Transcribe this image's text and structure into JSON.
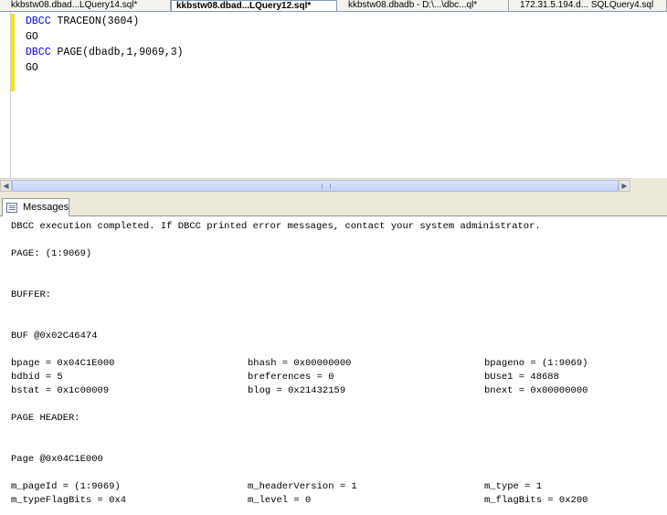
{
  "tabs": [
    {
      "label": "kkbstw08.dbad...LQuery14.sql*",
      "active": false
    },
    {
      "label": "kkbstw08.dbad...LQuery12.sql*",
      "active": true
    },
    {
      "label": "kkbstw08.dbadb - D:\\...\\dbc...ql*",
      "active": false
    },
    {
      "label": "172.31.5.194.d... SQLQuery4.sql",
      "active": false
    }
  ],
  "editor": {
    "lines": [
      {
        "kw": "DBCC",
        "rest": " TRACEON(3604)"
      },
      {
        "kw": "",
        "rest": "GO"
      },
      {
        "kw": "DBCC",
        "rest": " PAGE(dbadb,1,9069,3)"
      },
      {
        "kw": "",
        "rest": "GO"
      }
    ]
  },
  "results": {
    "tab_label": "Messages"
  },
  "messages": {
    "completed": "DBCC execution completed. If DBCC printed error messages, contact your system administrator.",
    "page": "PAGE: (1:9069)",
    "buffer": "BUFFER:",
    "buf": "BUF @0x02C46474",
    "buf_rows": [
      [
        "bpage = 0x04C1E000",
        "bhash = 0x00000000",
        "bpageno = (1:9069)"
      ],
      [
        "bdbid = 5",
        "breferences = 0",
        "bUse1 = 48688"
      ],
      [
        "bstat = 0x1c00009",
        "blog = 0x21432159",
        "bnext = 0x00000000"
      ]
    ],
    "page_header": "PAGE HEADER:",
    "page_at": "Page @0x04C1E000",
    "header_rows": [
      [
        "m_pageId = (1:9069)",
        "m_headerVersion = 1",
        "m_type = 1"
      ],
      [
        "m_typeFlagBits = 0x4",
        "m_level = 0",
        "m_flagBits = 0x200"
      ]
    ]
  }
}
